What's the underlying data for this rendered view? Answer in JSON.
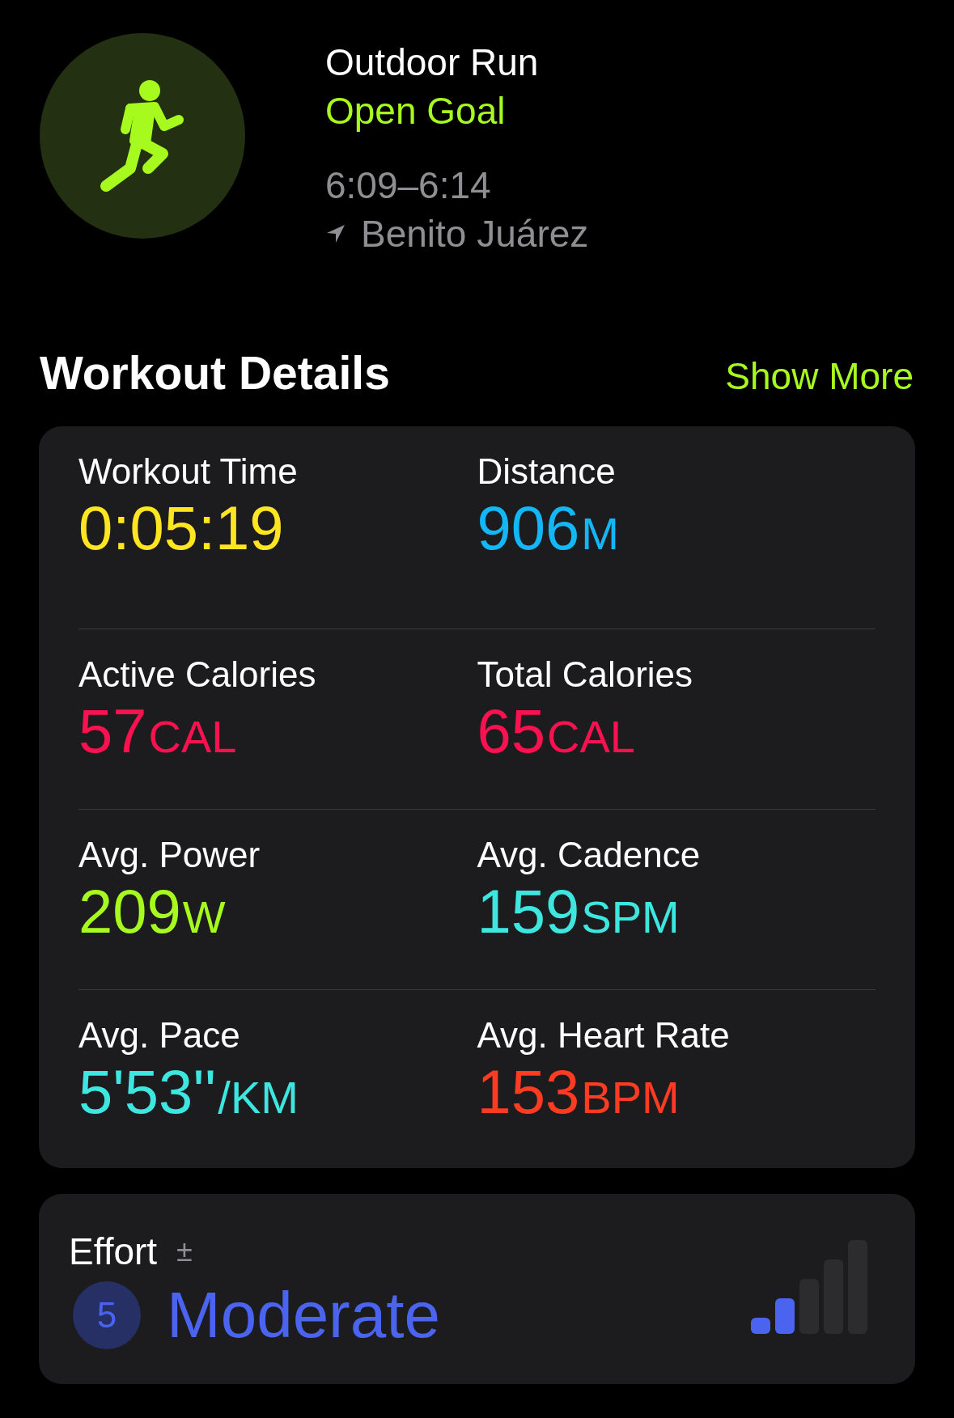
{
  "workout": {
    "title": "Outdoor Run",
    "goal": "Open Goal",
    "time": "6:09–6:14",
    "location": "Benito Juárez"
  },
  "details": {
    "title": "Workout Details",
    "action": "Show More",
    "metrics": [
      {
        "label": "Workout Time",
        "value": "0:05:19",
        "color": "#ffe620"
      },
      {
        "label": "Distance",
        "value": "906",
        "unit": "M",
        "color": "#13b7f5"
      },
      {
        "label": "Active Calories",
        "value": "57",
        "unit": "CAL",
        "color": "#fa1150"
      },
      {
        "label": "Total Calories",
        "value": "65",
        "unit": "CAL",
        "color": "#fa1150"
      },
      {
        "label": "Avg. Power",
        "value": "209",
        "unit": "W",
        "color": "#a6fa1d"
      },
      {
        "label": "Avg. Cadence",
        "value": "159",
        "unit": "SPM",
        "color": "#3ee6e0"
      },
      {
        "label": "Avg. Pace",
        "value": "5'53''",
        "unit": "/KM",
        "color": "#3ee6e0"
      },
      {
        "label": "Avg. Heart Rate",
        "value": "153",
        "unit": "BPM",
        "color": "#ff3b22"
      }
    ]
  },
  "effort": {
    "title": "Effort",
    "adjust": "±",
    "score": "5",
    "rating": "Moderate",
    "level": 0.4
  }
}
